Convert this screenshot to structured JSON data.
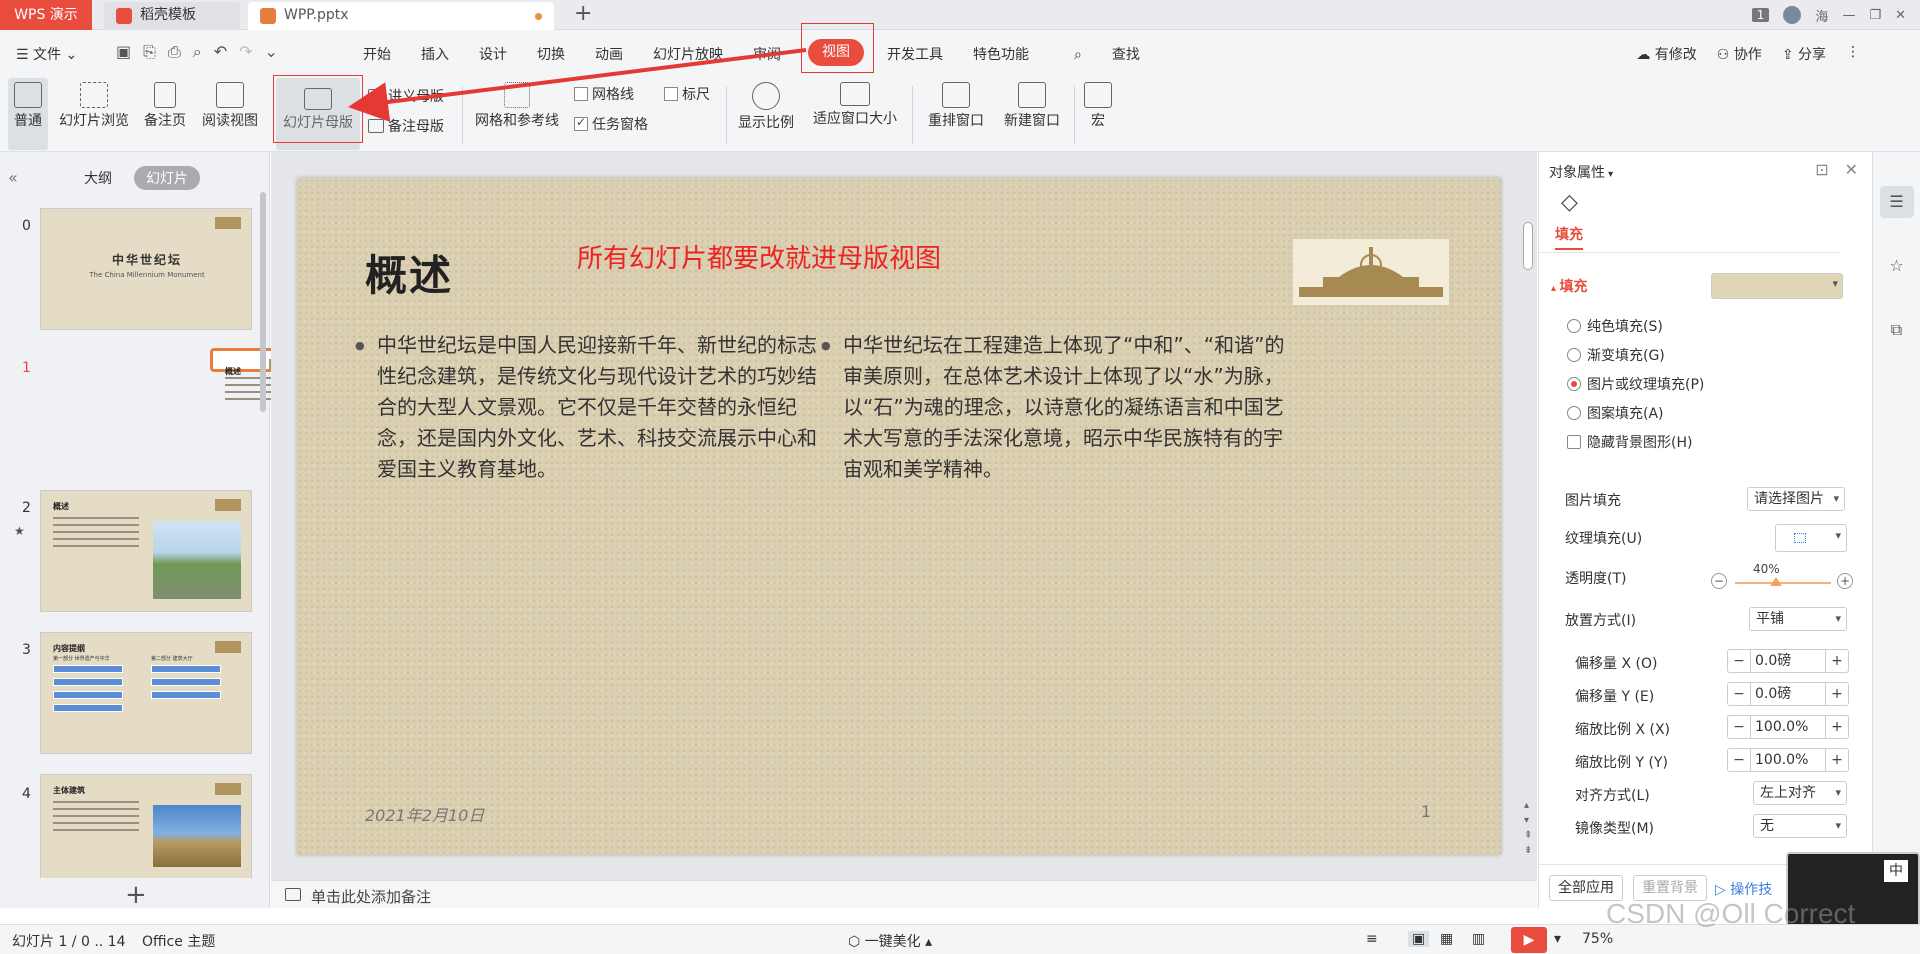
{
  "titlebar": {
    "app_tab": "WPS 演示",
    "tabs": [
      {
        "label": "稻壳模板"
      },
      {
        "label": "WPP.pptx"
      }
    ],
    "badge": "1",
    "user": "海"
  },
  "menu": {
    "file": "文件",
    "tabs": [
      "开始",
      "插入",
      "设计",
      "切换",
      "动画",
      "幻灯片放映",
      "审阅"
    ],
    "active": "视图",
    "after": [
      "开发工具",
      "特色功能",
      "查找"
    ],
    "right": [
      "有修改",
      "协作",
      "分享"
    ]
  },
  "ribbon": {
    "normal": "普通",
    "browse": "幻灯片浏览",
    "notes_page": "备注页",
    "reading": "阅读视图",
    "master": "幻灯片母版",
    "handout_master": "讲义母版",
    "notes_master": "备注母版",
    "grid_guides": "网格和参考线",
    "gridlines": "网格线",
    "ruler": "标尺",
    "task_pane": "任务窗格",
    "zoom": "显示比例",
    "fit_window": "适应窗口大小",
    "arrange": "重排窗口",
    "new_window": "新建窗口",
    "macro": "宏"
  },
  "leftpanel": {
    "tab_outline": "大纲",
    "tab_slides": "幻灯片",
    "thumbs": [
      {
        "num": "0",
        "title": "中华世纪坛",
        "subtitle": "The China Millennium Monument"
      },
      {
        "num": "1",
        "title": "概述"
      },
      {
        "num": "2",
        "title": "概述"
      },
      {
        "num": "3",
        "title": "内容提纲",
        "left": "第一部分 世界遗产与中华",
        "right": "第二部分 建筑大厅"
      },
      {
        "num": "4",
        "title": "主体建筑"
      }
    ]
  },
  "slide": {
    "title": "概述",
    "annotation": "所有幻灯片都要改就进母版视图",
    "col1": "中华世纪坛是中国人民迎接新千年、新世纪的标志性纪念建筑，是传统文化与现代设计艺术的巧妙结合的大型人文景观。它不仅是千年交替的永恒纪念，还是国内外文化、艺术、科技交流展示中心和爱国主义教育基地。",
    "col2": "中华世纪坛在工程建造上体现了“中和”、“和谐”的审美原则，在总体艺术设计上体现了以“水”为脉，以“石”为魂的理念，以诗意化的凝练语言和中国艺术大写意的手法深化意境，昭示中华民族特有的宇宙观和美学精神。",
    "date": "2021年2月10日",
    "page": "1"
  },
  "notes_placeholder": "单击此处添加备注",
  "rightpane": {
    "title": "对象属性",
    "fill_tab": "填充",
    "section": "填充",
    "options": [
      "纯色填充(S)",
      "渐变填充(G)",
      "图片或纹理填充(P)",
      "图案填充(A)"
    ],
    "selected_option": 2,
    "hide_bg": "隐藏背景图形(H)",
    "pic_fill_label": "图片填充",
    "pic_fill_value": "请选择图片",
    "texture_label": "纹理填充(U)",
    "transparency_label": "透明度(T)",
    "transparency_value": "40%",
    "placement_label": "放置方式(I)",
    "placement_value": "平铺",
    "offset_x_label": "偏移量 X (O)",
    "offset_x_value": "0.0磅",
    "offset_y_label": "偏移量 Y (E)",
    "offset_y_value": "0.0磅",
    "scale_x_label": "缩放比例 X (X)",
    "scale_x_value": "100.0%",
    "scale_y_label": "缩放比例 Y (Y)",
    "scale_y_value": "100.0%",
    "align_label": "对齐方式(L)",
    "align_value": "左上对齐",
    "mirror_label": "镜像类型(M)",
    "mirror_value": "无",
    "apply_all": "全部应用",
    "reset_bg": "重置背景",
    "tips": "操作技",
    "ime": "中"
  },
  "statusbar": {
    "slide_info": "幻灯片 1 / 0 .. 14",
    "theme": "Office 主题",
    "beautify": "一键美化",
    "zoom": "75%"
  },
  "watermark": "CSDN @Oll Correct",
  "colors": {
    "accent": "#e84c3d",
    "annotation": "#e22222",
    "slide_bg": "#dacfb1"
  }
}
